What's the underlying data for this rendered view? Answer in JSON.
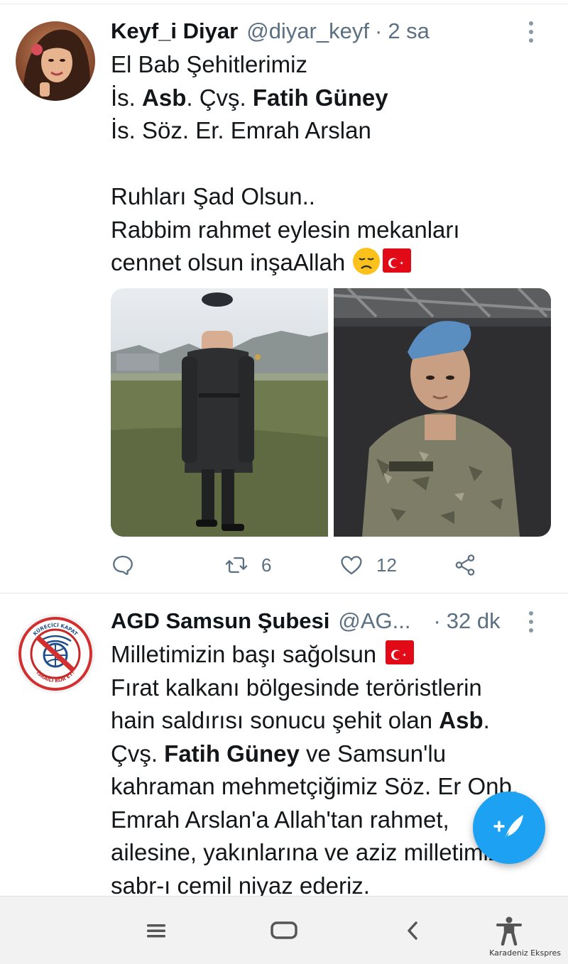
{
  "tweets": [
    {
      "display_name": "Keyf_i Diyar",
      "handle": "@diyar_keyf",
      "separator": "·",
      "time": "2 sa",
      "avatar_icon": "profile-photo",
      "lines": {
        "l1": "El Bab Şehitlerimiz",
        "l2_a": "İs. ",
        "l2_b": "Asb",
        "l2_c": ". Çvş. ",
        "l2_d": "Fatih Güney",
        "l3": "İs. Söz. Er. Emrah Arslan",
        "l5": "Ruhları Şad Olsun..",
        "l6": "Rabbim rahmet eylesin mekanları",
        "l7": "cennet olsun inşaAllah"
      },
      "media_icons": [
        "soldier-photo-coat",
        "soldier-photo-beret"
      ],
      "actions": {
        "reply_count": "",
        "retweet_count": "6",
        "like_count": "12"
      }
    },
    {
      "display_name": "AGD Samsun Şubesi",
      "handle": "@AG...",
      "separator": "·",
      "time": "32 dk",
      "avatar_icon": "agd-logo",
      "avatar_text_top": "KÜRECİCİ KAPAT",
      "avatar_text_bottom": "İSRAİLİ KÖR ET!",
      "lines": {
        "l1": "Milletimizin başı sağolsun",
        "l2": "Fırat kalkanı bölgesinde teröristlerin",
        "l3_a": "hain saldırısı sonucu şehit olan ",
        "l3_b": "Asb",
        "l3_c": ".",
        "l4_a": "Çvş. ",
        "l4_b": "Fatih Güney",
        "l4_c": " ve Samsun'lu",
        "l5": "kahraman mehmetçiğimiz Söz. Er Onb.",
        "l6": "Emrah Arslan'a Allah'tan rahmet,",
        "l7": "ailesine, yakınlarına ve aziz milletimize",
        "l8": "sabr-ı cemil niyaz ederiz."
      }
    }
  ],
  "fab": {
    "icon": "compose-tweet-icon",
    "color": "#1da1f2"
  },
  "navbar": {
    "buttons": [
      "menu-icon",
      "home-icon",
      "back-icon",
      "accessibility-icon"
    ]
  },
  "watermark": "Karadeniz Ekspres",
  "colors": {
    "text": "#14171a",
    "secondary": "#5b7083",
    "accent": "#1da1f2",
    "flag_red": "#e30a17"
  }
}
